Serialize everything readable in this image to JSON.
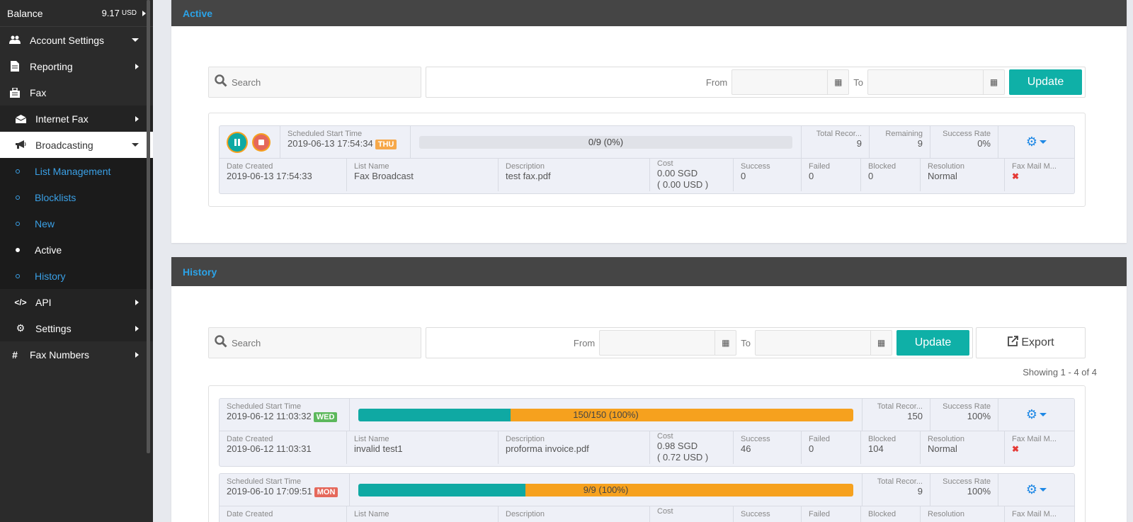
{
  "sidebar": {
    "balance_label": "Balance",
    "balance_amount": "9.17",
    "balance_unit": "USD",
    "items": [
      {
        "label": "Account Settings",
        "icon": "users-icon"
      },
      {
        "label": "Reporting",
        "icon": "document-icon"
      },
      {
        "label": "Fax",
        "icon": "briefcase-icon"
      },
      {
        "label": "Internet Fax",
        "icon": "envelope-icon"
      },
      {
        "label": "Broadcasting",
        "icon": "megaphone-icon"
      },
      {
        "label": "List Management"
      },
      {
        "label": "Blocklists"
      },
      {
        "label": "New"
      },
      {
        "label": "Active"
      },
      {
        "label": "History"
      },
      {
        "label": "API",
        "icon": "code-icon"
      },
      {
        "label": "Settings",
        "icon": "gears-icon"
      },
      {
        "label": "Fax Numbers",
        "icon": "hash-icon"
      }
    ]
  },
  "active": {
    "title": "Active",
    "search_placeholder": "Search",
    "from_label": "From",
    "to_label": "To",
    "update_label": "Update",
    "item": {
      "sched_caption": "Scheduled Start Time",
      "sched_time": "2019-06-13 17:54:34",
      "day": "THU",
      "progress_text": "0/9 (0%)",
      "total_caption": "Total Recor...",
      "total": "9",
      "remaining_caption": "Remaining",
      "remaining": "9",
      "rate_caption": "Success Rate",
      "rate": "0%",
      "created_caption": "Date Created",
      "created": "2019-06-13 17:54:33",
      "list_caption": "List Name",
      "list": "Fax Broadcast",
      "desc_caption": "Description",
      "desc": "test fax.pdf",
      "cost_caption": "Cost",
      "cost": "0.00 SGD",
      "cost_usd": "( 0.00 USD )",
      "success_caption": "Success",
      "success": "0",
      "failed_caption": "Failed",
      "failed": "0",
      "blocked_caption": "Blocked",
      "blocked": "0",
      "res_caption": "Resolution",
      "res": "Normal",
      "faxmail_caption": "Fax Mail M...",
      "faxmail": "✖"
    }
  },
  "history": {
    "title": "History",
    "search_placeholder": "Search",
    "from_label": "From",
    "to_label": "To",
    "update_label": "Update",
    "export_label": "Export",
    "showing": "Showing 1 - 4 of 4",
    "items": [
      {
        "sched_caption": "Scheduled Start Time",
        "sched_time": "2019-06-12 11:03:32",
        "day": "WED",
        "progress_text": "150/150 (100%)",
        "success_fraction": 0.307,
        "total_caption": "Total Recor...",
        "total": "150",
        "rate_caption": "Success Rate",
        "rate": "100%",
        "created_caption": "Date Created",
        "created": "2019-06-12 11:03:31",
        "list_caption": "List Name",
        "list": "invalid test1",
        "desc_caption": "Description",
        "desc": "proforma invoice.pdf",
        "cost_caption": "Cost",
        "cost": "0.98 SGD",
        "cost_usd": "( 0.72 USD )",
        "success_caption": "Success",
        "success": "46",
        "failed_caption": "Failed",
        "failed": "0",
        "blocked_caption": "Blocked",
        "blocked": "104",
        "res_caption": "Resolution",
        "res": "Normal",
        "faxmail_caption": "Fax Mail M...",
        "faxmail": "✖"
      },
      {
        "sched_caption": "Scheduled Start Time",
        "sched_time": "2019-06-10 17:09:51",
        "day": "MON",
        "progress_text": "9/9 (100%)",
        "success_fraction": 0.338,
        "total_caption": "Total Recor...",
        "total": "9",
        "rate_caption": "Success Rate",
        "rate": "100%",
        "created_caption": "Date Created",
        "list_caption": "List Name",
        "desc_caption": "Description",
        "cost_caption": "Cost",
        "success_caption": "Success",
        "failed_caption": "Failed",
        "blocked_caption": "Blocked",
        "res_caption": "Resolution",
        "faxmail_caption": "Fax Mail M..."
      }
    ]
  },
  "colors": {
    "teal": "#0fb0a7",
    "orange": "#f6a11e",
    "link_blue": "#2ba3e8",
    "badge_thu": "#f6a84a",
    "badge_wed": "#5cb85c",
    "badge_mon": "#e5685b"
  }
}
